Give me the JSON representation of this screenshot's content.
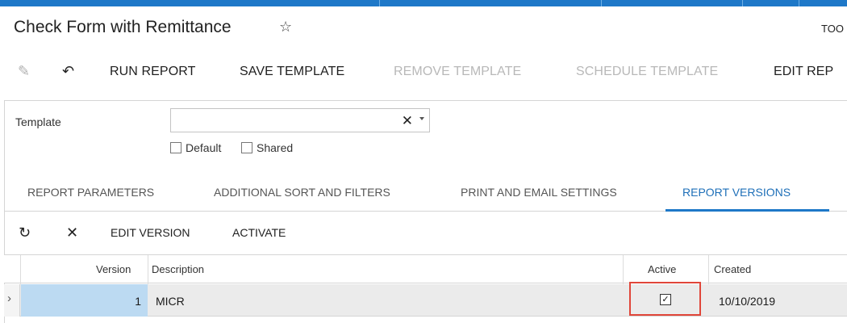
{
  "header": {
    "title": "Check Form with Remittance",
    "tools": "TOO"
  },
  "toolbar": {
    "run_report": "RUN REPORT",
    "save_template": "SAVE TEMPLATE",
    "remove_template": "REMOVE TEMPLATE",
    "schedule_template": "SCHEDULE TEMPLATE",
    "edit_report": "EDIT REP"
  },
  "form": {
    "template_label": "Template",
    "template_value": "",
    "default_label": "Default",
    "shared_label": "Shared"
  },
  "tabs": [
    {
      "label": "REPORT PARAMETERS",
      "active": false
    },
    {
      "label": "ADDITIONAL SORT AND FILTERS",
      "active": false
    },
    {
      "label": "PRINT AND EMAIL SETTINGS",
      "active": false
    },
    {
      "label": "REPORT VERSIONS",
      "active": true
    }
  ],
  "grid_toolbar": {
    "edit_version": "EDIT VERSION",
    "activate": "ACTIVATE"
  },
  "grid": {
    "columns": [
      "Version",
      "Description",
      "Active",
      "Created"
    ],
    "rows": [
      {
        "version": "1",
        "description": "MICR",
        "active": true,
        "created": "10/10/2019"
      }
    ]
  },
  "colors": {
    "accent": "#1e78c8",
    "selected_cell": "#bcdaf2",
    "highlight": "#e0463a"
  }
}
